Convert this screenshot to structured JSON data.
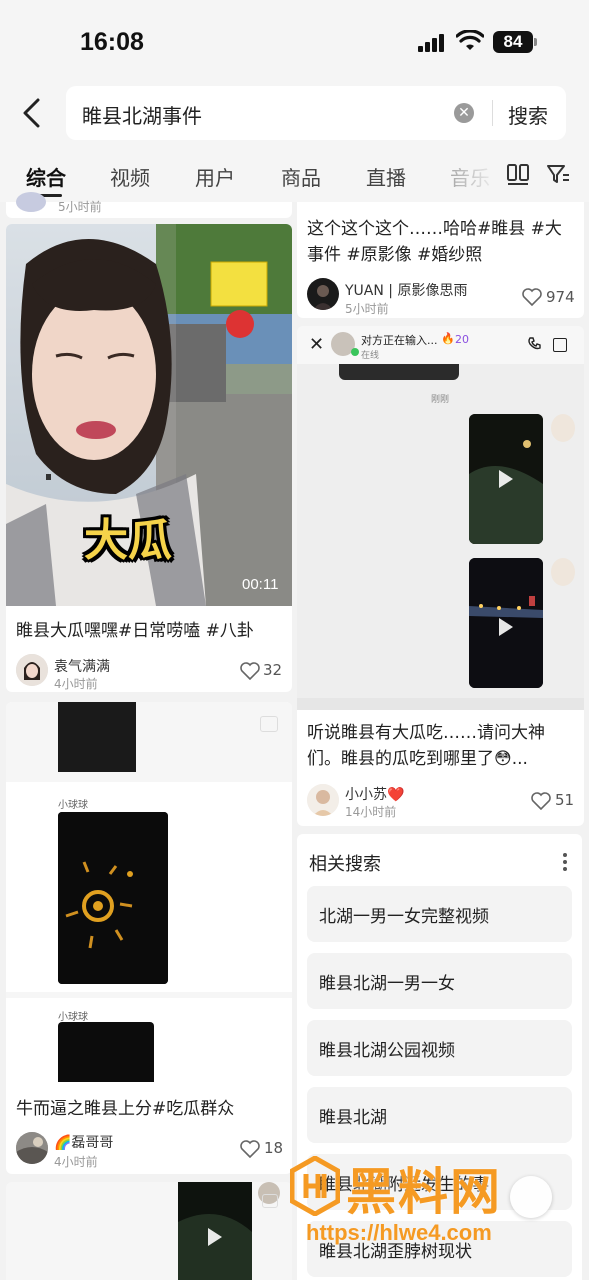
{
  "status_bar": {
    "time": "16:08",
    "battery": "84"
  },
  "search": {
    "query": "睢县北湖事件",
    "search_label": "搜索"
  },
  "tabs": [
    {
      "label": "综合",
      "active": true
    },
    {
      "label": "视频"
    },
    {
      "label": "用户"
    },
    {
      "label": "商品"
    },
    {
      "label": "直播"
    },
    {
      "label": "音乐"
    }
  ],
  "top_left_stub": {
    "time": "5小时前"
  },
  "cards": {
    "top_right": {
      "title": "这个这个这个……哈哈#睢县 #大事件 #原影像 #婚纱照",
      "author": "YUAN | 原影像思雨",
      "time": "5小时前",
      "likes": "974"
    },
    "big_melon": {
      "overlay": "大瓜",
      "duration": "00:11",
      "title": "睢县大瓜嘿嘿#日常唠嗑 #八卦",
      "author": "袁气满满",
      "time": "4小时前",
      "likes": "32"
    },
    "chat_card": {
      "chat_header": "对方正在输入...",
      "chat_status": "在线",
      "fire_count": "20",
      "chat_time": "刚刚",
      "title": "听说睢县有大瓜吃……请问大神们。睢县的瓜吃到哪里了😳...",
      "author": "小小苏❤️",
      "time": "14小时前",
      "likes": "51"
    },
    "melon_group": {
      "sender1": "小球球",
      "sender2": "小球球",
      "title": "牛而逼之睢县上分#吃瓜群众",
      "author": "🌈磊哥哥",
      "time": "4小时前",
      "likes": "18"
    }
  },
  "related": {
    "heading": "相关搜索",
    "items": [
      "北湖一男一女完整视频",
      "睢县北湖一男一女",
      "睢县北湖公园视频",
      "睢县北湖",
      "睢县北湖附近发生的事",
      "睢县北湖歪脖树现状"
    ]
  },
  "watermark": {
    "text": "黑料网",
    "url": "https://hlwe4.com"
  },
  "colors": {
    "accent": "#f59a23",
    "page_bg": "#f2f2f2",
    "like_gray": "#555555"
  }
}
